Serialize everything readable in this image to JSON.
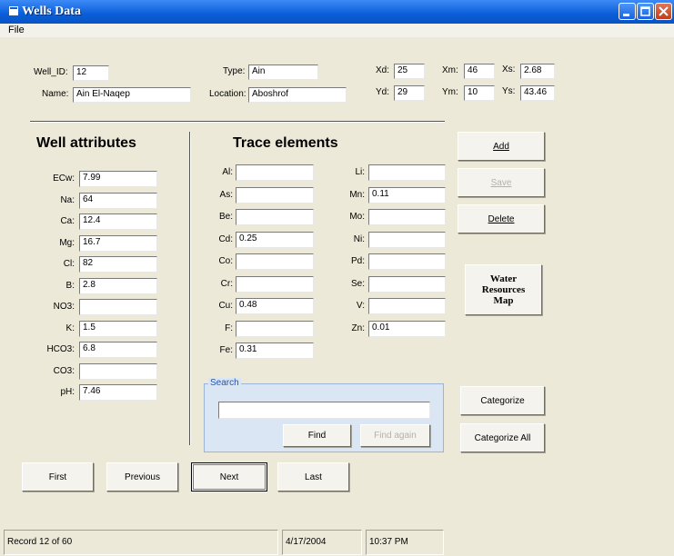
{
  "window": {
    "title": "Wells Data",
    "menu": [
      "File"
    ]
  },
  "header": {
    "well_id": {
      "label": "Well_ID:",
      "value": "12"
    },
    "name": {
      "label": "Name:",
      "value": "Ain El-Naqep"
    },
    "type": {
      "label": "Type:",
      "value": "Ain"
    },
    "location": {
      "label": "Location:",
      "value": "Aboshrof"
    },
    "xd": {
      "label": "Xd:",
      "value": "25"
    },
    "yd": {
      "label": "Yd:",
      "value": "29"
    },
    "xm": {
      "label": "Xm:",
      "value": "46"
    },
    "ym": {
      "label": "Ym:",
      "value": "10"
    },
    "xs": {
      "label": "Xs:",
      "value": "2.68"
    },
    "ys": {
      "label": "Ys:",
      "value": "43.46"
    }
  },
  "well_attributes": {
    "heading": "Well attributes",
    "fields": [
      {
        "label": "ECw:",
        "value": "7.99"
      },
      {
        "label": "Na:",
        "value": "64"
      },
      {
        "label": "Ca:",
        "value": "12.4"
      },
      {
        "label": "Mg:",
        "value": "16.7"
      },
      {
        "label": "Cl:",
        "value": "82"
      },
      {
        "label": "B:",
        "value": "2.8"
      },
      {
        "label": "NO3:",
        "value": ""
      },
      {
        "label": "K:",
        "value": "1.5"
      },
      {
        "label": "HCO3:",
        "value": "6.8"
      },
      {
        "label": "CO3:",
        "value": ""
      },
      {
        "label": "pH:",
        "value": "7.46"
      }
    ]
  },
  "trace_elements": {
    "heading": "Trace elements",
    "left": [
      {
        "label": "Al:",
        "value": ""
      },
      {
        "label": "As:",
        "value": ""
      },
      {
        "label": "Be:",
        "value": ""
      },
      {
        "label": "Cd:",
        "value": "0.25"
      },
      {
        "label": "Co:",
        "value": ""
      },
      {
        "label": "Cr:",
        "value": ""
      },
      {
        "label": "Cu:",
        "value": "0.48"
      },
      {
        "label": "F:",
        "value": ""
      },
      {
        "label": "Fe:",
        "value": "0.31"
      }
    ],
    "right": [
      {
        "label": "Li:",
        "value": ""
      },
      {
        "label": "Mn:",
        "value": "0.11"
      },
      {
        "label": "Mo:",
        "value": ""
      },
      {
        "label": "Ni:",
        "value": ""
      },
      {
        "label": "Pd:",
        "value": ""
      },
      {
        "label": "Se:",
        "value": ""
      },
      {
        "label": "V:",
        "value": ""
      },
      {
        "label": "Zn:",
        "value": "0.01"
      }
    ]
  },
  "actions": {
    "add": "Add",
    "save": "Save",
    "delete": "Delete",
    "map_line1": "Water",
    "map_line2": "Resources",
    "map_line3": "Map",
    "categorize": "Categorize",
    "categorize_all": "Categorize All"
  },
  "search": {
    "legend": "Search",
    "value": "",
    "find": "Find",
    "find_again": "Find again"
  },
  "navigation": {
    "first": "First",
    "previous": "Previous",
    "next": "Next",
    "last": "Last"
  },
  "status": {
    "record": "Record 12 of 60",
    "date": "4/17/2004",
    "time": "10:37 PM"
  }
}
